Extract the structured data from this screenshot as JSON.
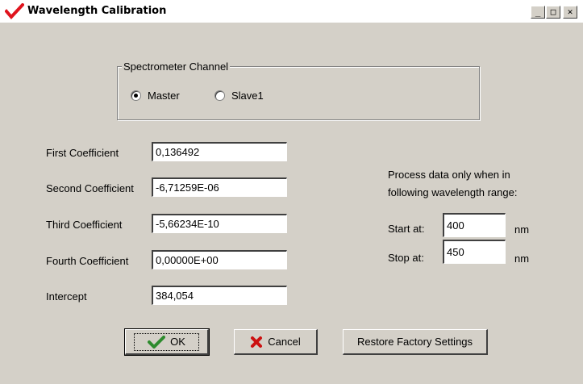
{
  "window": {
    "title": "Wavelength Calibration",
    "controls": {
      "minimize": "_",
      "maximize": "□",
      "close": "✕"
    }
  },
  "channel": {
    "group_title": "Spectrometer Channel",
    "options": [
      {
        "label": "Master",
        "checked": true
      },
      {
        "label": "Slave1",
        "checked": false
      }
    ]
  },
  "coefficients": {
    "first_label": "First Coefficient",
    "first_value": "0,136492",
    "second_label": "Second Coefficient",
    "second_value": "-6,71259E-06",
    "third_label": "Third Coefficient",
    "third_value": "-5,66234E-10",
    "fourth_label": "Fourth Coefficient",
    "fourth_value": "0,00000E+00",
    "intercept_label": "Intercept",
    "intercept_value": "384,054"
  },
  "range": {
    "note_line1": "Process data only when in",
    "note_line2": "following wavelength range:",
    "start_label": "Start at:",
    "start_value": "400",
    "stop_label": "Stop at:",
    "stop_value": "450",
    "unit": "nm"
  },
  "buttons": {
    "ok": "OK",
    "cancel": "Cancel",
    "restore": "Restore Factory Settings"
  },
  "colors": {
    "dialog_bg": "#d4d0c8",
    "ok_check": "#2e8b2e",
    "cancel_x": "#cc1111",
    "app_icon": "#e0141e"
  },
  "icons": [
    "app-checkmark-icon",
    "minimize-icon",
    "maximize-icon",
    "close-icon",
    "ok-checkmark-icon",
    "cancel-x-icon"
  ]
}
